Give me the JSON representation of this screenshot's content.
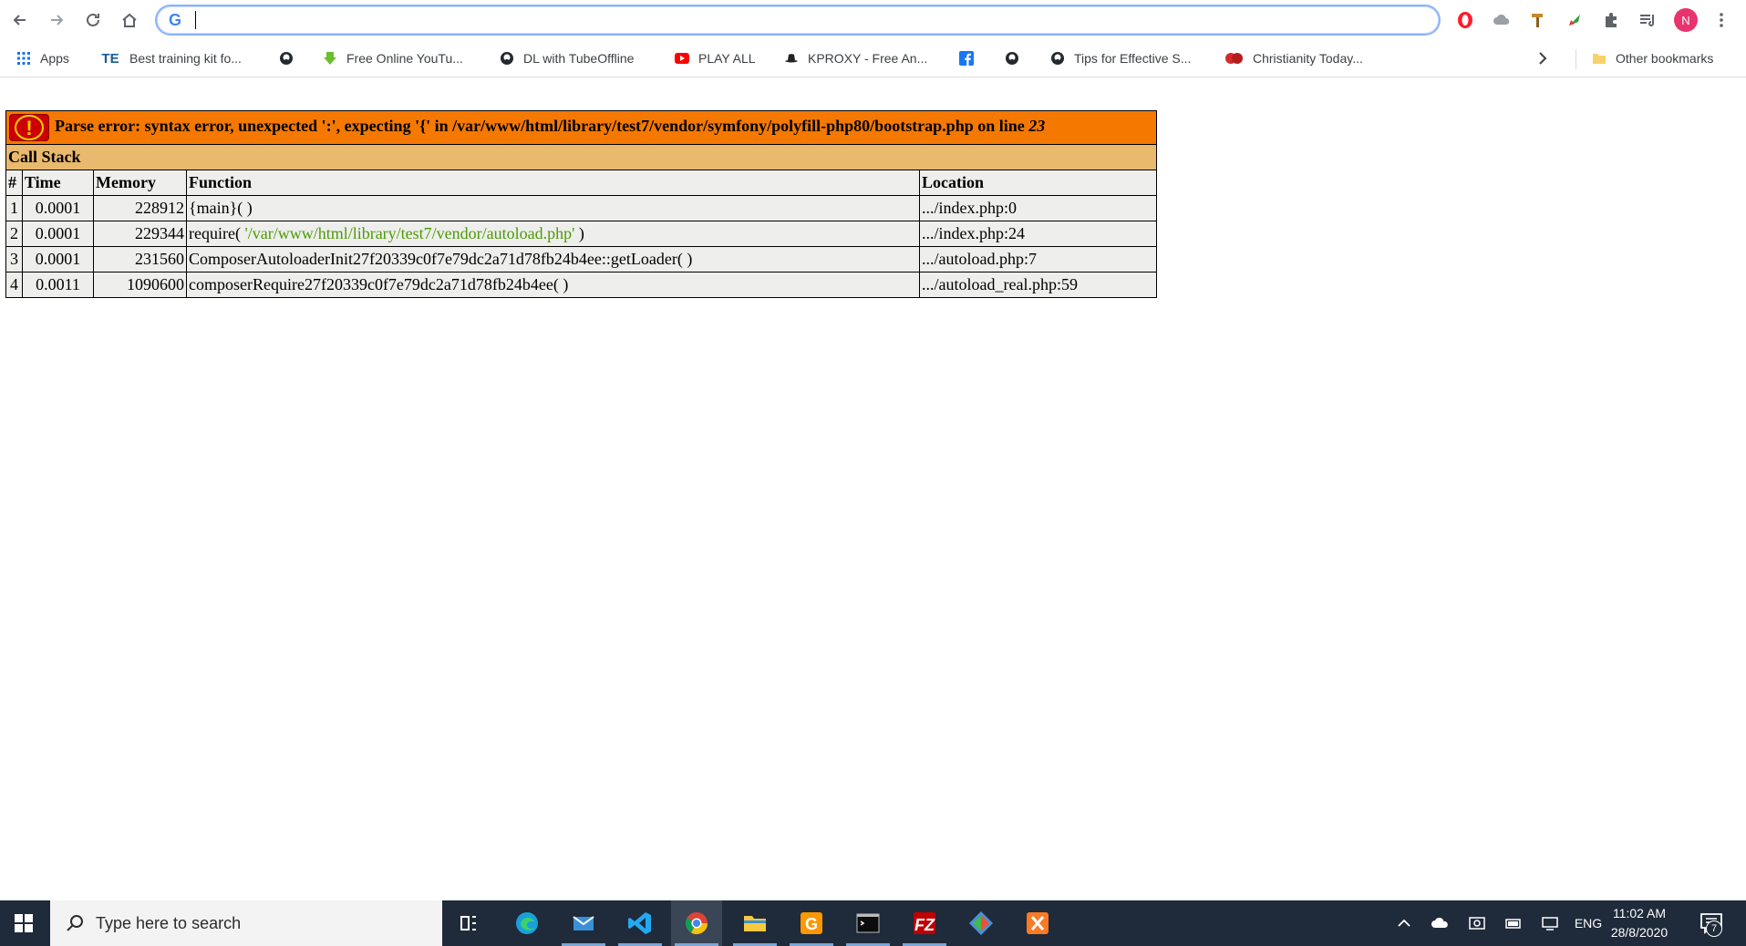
{
  "browser": {
    "omnibox": {
      "value": "",
      "placeholder": ""
    },
    "avatar_letter": "N",
    "bookmarks": [
      {
        "label": "Apps",
        "icon": "apps-grid-icon"
      },
      {
        "label": "Best training kit fo...",
        "icon": "te-icon"
      },
      {
        "label": "",
        "icon": "github-icon"
      },
      {
        "label": "Free Online YouTu...",
        "icon": "download-arrow-icon"
      },
      {
        "label": "DL with TubeOffline",
        "icon": "github-icon"
      },
      {
        "label": "PLAY ALL",
        "icon": "youtube-icon"
      },
      {
        "label": "KPROXY - Free An...",
        "icon": "hat-icon"
      },
      {
        "label": "",
        "icon": "facebook-icon"
      },
      {
        "label": "",
        "icon": "github-icon"
      },
      {
        "label": "Tips for Effective S...",
        "icon": "github-icon"
      },
      {
        "label": "Christianity Today...",
        "icon": "ct-icon"
      }
    ],
    "other_bookmarks": "Other bookmarks",
    "te_label": "TE"
  },
  "error": {
    "message_prefix": "Parse error: syntax error, unexpected ':', expecting '{' in /var/www/html/library/test7/vendor/symfony/polyfill-php80/bootstrap.php on line ",
    "line": "23",
    "call_stack_title": "Call Stack",
    "columns": [
      "#",
      "Time",
      "Memory",
      "Function",
      "Location"
    ],
    "rows": [
      {
        "n": "1",
        "time": "0.0001",
        "memory": "228912",
        "function": "{main}( )",
        "arg": "",
        "function_suffix": "",
        "location": ".../index.php:0"
      },
      {
        "n": "2",
        "time": "0.0001",
        "memory": "229344",
        "function": "require( ",
        "arg": "'/var/www/html/library/test7/vendor/autoload.php'",
        "function_suffix": " )",
        "location": ".../index.php:24"
      },
      {
        "n": "3",
        "time": "0.0001",
        "memory": "231560",
        "function": "ComposerAutoloaderInit27f20339c0f7e79dc2a71d78fb24b4ee::getLoader( )",
        "arg": "",
        "function_suffix": "",
        "location": ".../autoload.php:7"
      },
      {
        "n": "4",
        "time": "0.0011",
        "memory": "1090600",
        "function": "composerRequire27f20339c0f7e79dc2a71d78fb24b4ee( )",
        "arg": "",
        "function_suffix": "",
        "location": ".../autoload_real.php:59"
      }
    ]
  },
  "taskbar": {
    "search_placeholder": "Type here to search",
    "language": "ENG",
    "time": "11:02 AM",
    "date": "28/8/2020",
    "notification_count": "7",
    "apps": [
      "task-view-icon",
      "edge-icon",
      "mail-icon",
      "vscode-icon",
      "chrome-icon",
      "file-explorer-icon",
      "sublime-icon",
      "terminal-icon",
      "filezilla-icon",
      "git-icon",
      "xampp-icon"
    ]
  },
  "colors": {
    "error_bg": "#f57900",
    "callstack_bg": "#e9b96e",
    "cell_bg": "#eeeeec",
    "string_green": "#4e9a06",
    "taskbar_bg": "#1f2a3a"
  }
}
